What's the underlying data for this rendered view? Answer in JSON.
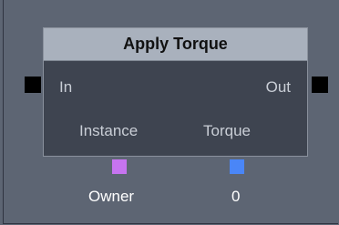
{
  "node": {
    "title": "Apply Torque",
    "input_label": "In",
    "output_label": "Out",
    "params": [
      {
        "label": "Instance",
        "color": "#c774f0",
        "value": "Owner"
      },
      {
        "label": "Torque",
        "color": "#4a86f7",
        "value": "0"
      }
    ]
  },
  "colors": {
    "background": "#5d6573",
    "node_body": "#3e4450",
    "header": "#a9b1bd",
    "pin": "#000000"
  }
}
